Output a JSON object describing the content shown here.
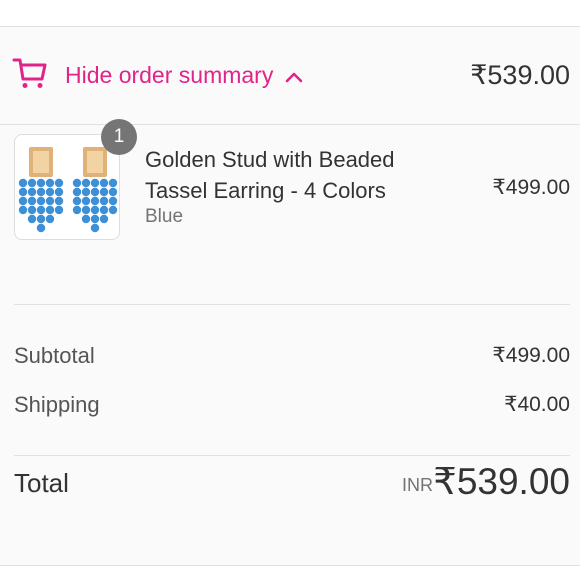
{
  "summary": {
    "toggle_label": "Hide order summary",
    "header_total": "₹539.00",
    "accent_color": "#e0248a"
  },
  "line_items": [
    {
      "quantity": "1",
      "title": "Golden Stud with Beaded Tassel Earring - 4 Colors",
      "variant": "Blue",
      "price": "₹499.00",
      "image_icon": "earring-product-image"
    }
  ],
  "totals": {
    "subtotal_label": "Subtotal",
    "subtotal_value": "₹499.00",
    "shipping_label": "Shipping",
    "shipping_value": "₹40.00",
    "total_label": "Total",
    "currency": "INR",
    "total_value": "₹539.00"
  }
}
